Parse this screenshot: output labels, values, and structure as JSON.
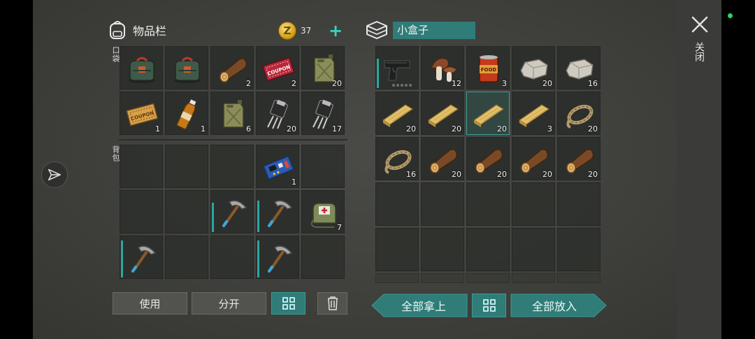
{
  "inventory": {
    "title": "物品栏",
    "coins": "37",
    "coin_symbol": "Z",
    "pocket_label": "口袋",
    "backpack_label": "背包",
    "pocket": [
      {
        "item": "supply-bag",
        "qty": ""
      },
      {
        "item": "supply-bag",
        "qty": ""
      },
      {
        "item": "log",
        "qty": "2"
      },
      {
        "item": "red-coupon",
        "qty": "2"
      },
      {
        "item": "jerrycan",
        "qty": "20"
      },
      {
        "item": "gold-coupon",
        "qty": "1"
      },
      {
        "item": "soda-bottle",
        "qty": "1"
      },
      {
        "item": "jerrycan",
        "qty": "6"
      },
      {
        "item": "transistor",
        "qty": "20"
      },
      {
        "item": "transistor",
        "qty": "17"
      }
    ],
    "backpack": [
      {
        "item": "",
        "qty": ""
      },
      {
        "item": "",
        "qty": ""
      },
      {
        "item": "",
        "qty": ""
      },
      {
        "item": "circuit-board",
        "qty": "1"
      },
      {
        "item": "",
        "qty": ""
      },
      {
        "item": "",
        "qty": ""
      },
      {
        "item": "",
        "qty": ""
      },
      {
        "item": "pickaxe",
        "qty": "",
        "durability": 0.75
      },
      {
        "item": "pickaxe",
        "qty": "",
        "durability": 0.8
      },
      {
        "item": "medkit-bag",
        "qty": "7"
      },
      {
        "item": "pickaxe",
        "qty": "",
        "durability": 0.95
      },
      {
        "item": "",
        "qty": ""
      },
      {
        "item": "",
        "qty": ""
      },
      {
        "item": "pickaxe",
        "qty": "",
        "durability": 0.95
      },
      {
        "item": "",
        "qty": ""
      }
    ],
    "buttons": {
      "use": "使用",
      "split": "分开"
    }
  },
  "container": {
    "title": "小盒子",
    "items": [
      {
        "item": "pistol",
        "qty": "",
        "durability": 0.75
      },
      {
        "item": "mushroom",
        "qty": "12"
      },
      {
        "item": "food-can",
        "qty": "3"
      },
      {
        "item": "stone",
        "qty": "20"
      },
      {
        "item": "stone",
        "qty": "16"
      },
      {
        "item": "plank",
        "qty": "20"
      },
      {
        "item": "plank",
        "qty": "20"
      },
      {
        "item": "plank",
        "qty": "20",
        "selected": true
      },
      {
        "item": "plank",
        "qty": "3"
      },
      {
        "item": "rope",
        "qty": "20"
      },
      {
        "item": "rope",
        "qty": "16"
      },
      {
        "item": "log",
        "qty": "20"
      },
      {
        "item": "log",
        "qty": "20"
      },
      {
        "item": "log",
        "qty": "20"
      },
      {
        "item": "log",
        "qty": "20"
      }
    ],
    "empty_rows": 3,
    "buttons": {
      "take_all": "全部拿上",
      "put_all": "全部放入"
    }
  },
  "close_label": "关闭",
  "colors": {
    "accent": "#2f7c78",
    "status": "#2fd35b"
  }
}
